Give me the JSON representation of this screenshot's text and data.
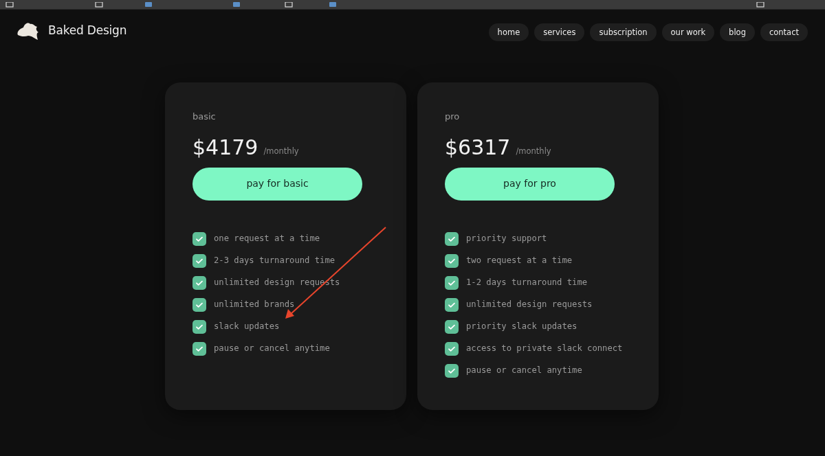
{
  "bookmarks_bar": {
    "items": [
      {
        "kind": "folder"
      },
      {
        "kind": "folder"
      },
      {
        "kind": "site"
      },
      {
        "kind": "site"
      },
      {
        "kind": "folder"
      },
      {
        "kind": "site"
      }
    ],
    "end_item": {
      "kind": "folder"
    }
  },
  "brand": {
    "name": "Baked Design"
  },
  "nav": [
    {
      "label": "home"
    },
    {
      "label": "services"
    },
    {
      "label": "subscription"
    },
    {
      "label": "our work"
    },
    {
      "label": "blog"
    },
    {
      "label": "contact"
    }
  ],
  "plans": [
    {
      "name": "basic",
      "price": "$4179",
      "period": "/monthly",
      "button": "pay for basic",
      "features": [
        "one request at a time",
        "2-3 days turnaround time",
        "unlimited design requests",
        "unlimited brands",
        "slack updates",
        "pause or cancel anytime"
      ]
    },
    {
      "name": "pro",
      "price": "$6317",
      "period": "/monthly",
      "button": "pay for pro",
      "features": [
        "priority support",
        "two request at a time",
        "1-2 days turnaround time",
        "unlimited design requests",
        "priority slack updates",
        "access to private slack connect",
        "pause or cancel anytime"
      ]
    }
  ],
  "annotation": {
    "kind": "arrow",
    "color": "#e8452c"
  }
}
